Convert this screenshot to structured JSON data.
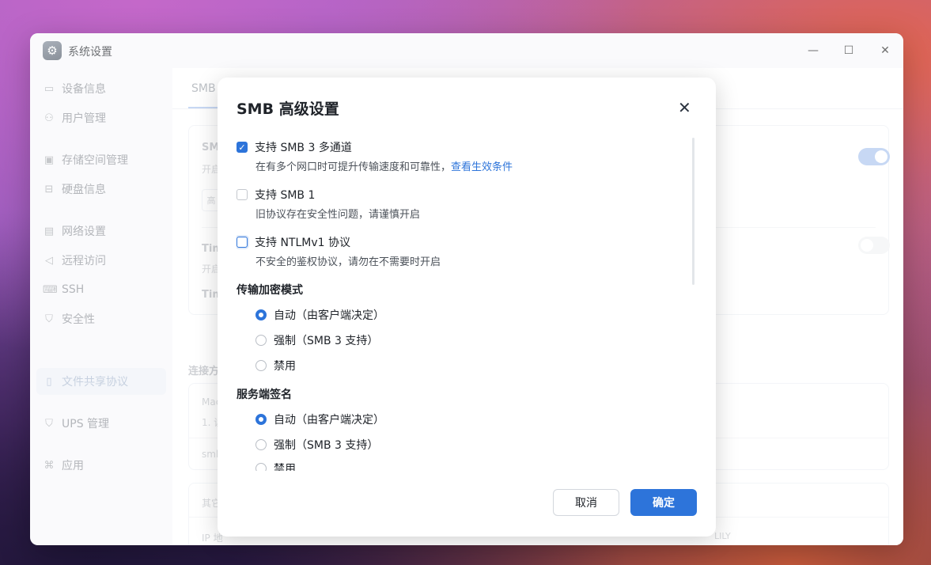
{
  "window": {
    "title": "系统设置",
    "controls": {
      "minimize": "—",
      "maximize": "☐",
      "close": "✕"
    }
  },
  "sidebar": {
    "items": [
      {
        "label": "设备信息",
        "icon": "device-icon",
        "glyph": "▭"
      },
      {
        "label": "用户管理",
        "icon": "user-icon",
        "glyph": "⚇"
      },
      {
        "label": "存储空间管理",
        "icon": "storage-icon",
        "glyph": "▣"
      },
      {
        "label": "硬盘信息",
        "icon": "disk-icon",
        "glyph": "⊟"
      },
      {
        "label": "网络设置",
        "icon": "network-icon",
        "glyph": "▤"
      },
      {
        "label": "远程访问",
        "icon": "send-icon",
        "glyph": "◁"
      },
      {
        "label": "SSH",
        "icon": "code-icon",
        "glyph": "⌨"
      },
      {
        "label": "安全性",
        "icon": "shield-check-icon",
        "glyph": "⛉"
      },
      {
        "label": "文件共享协议",
        "icon": "document-icon",
        "glyph": "▯"
      },
      {
        "label": "UPS 管理",
        "icon": "ups-shield-icon",
        "glyph": "⛉"
      },
      {
        "label": "应用",
        "icon": "apps-icon",
        "glyph": "⌘"
      }
    ],
    "active_index": 8
  },
  "main": {
    "tab": "SMB",
    "ghost": {
      "card1_title": "SM",
      "card1_sub": "开启",
      "card1_btn": "高",
      "time1": "Tim",
      "time1_sub": "开启",
      "time2": "Tim",
      "conn": "连接方",
      "mac": "Mac",
      "step": "1. 读",
      "smb_prefix": "smb",
      "other": "其它",
      "ip": "IP 地",
      "lily": "LILY"
    }
  },
  "dialog": {
    "title": "SMB 高级设置",
    "close_glyph": "✕",
    "options": [
      {
        "label": "支持 SMB 3 多通道",
        "checked": true,
        "desc": "在有多个网口时可提升传输速度和可靠性，",
        "link": "查看生效条件"
      },
      {
        "label": "支持 SMB 1",
        "checked": false,
        "desc": "旧协议存在安全性问题，请谨慎开启"
      },
      {
        "label": "支持 NTLMv1 协议",
        "checked": false,
        "desc": "不安全的鉴权协议，请勿在不需要时开启"
      }
    ],
    "encryption": {
      "title": "传输加密模式",
      "options": [
        "自动（由客户端决定）",
        "强制（SMB 3 支持）",
        "禁用"
      ],
      "selected": 0
    },
    "signing": {
      "title": "服务端签名",
      "options": [
        "自动（由客户端决定）",
        "强制（SMB 3 支持）",
        "禁用"
      ],
      "selected": 0
    },
    "buttons": {
      "cancel": "取消",
      "ok": "确定"
    }
  },
  "colors": {
    "accent": "#2d74da",
    "toggle_on": "#a9c4ee"
  }
}
